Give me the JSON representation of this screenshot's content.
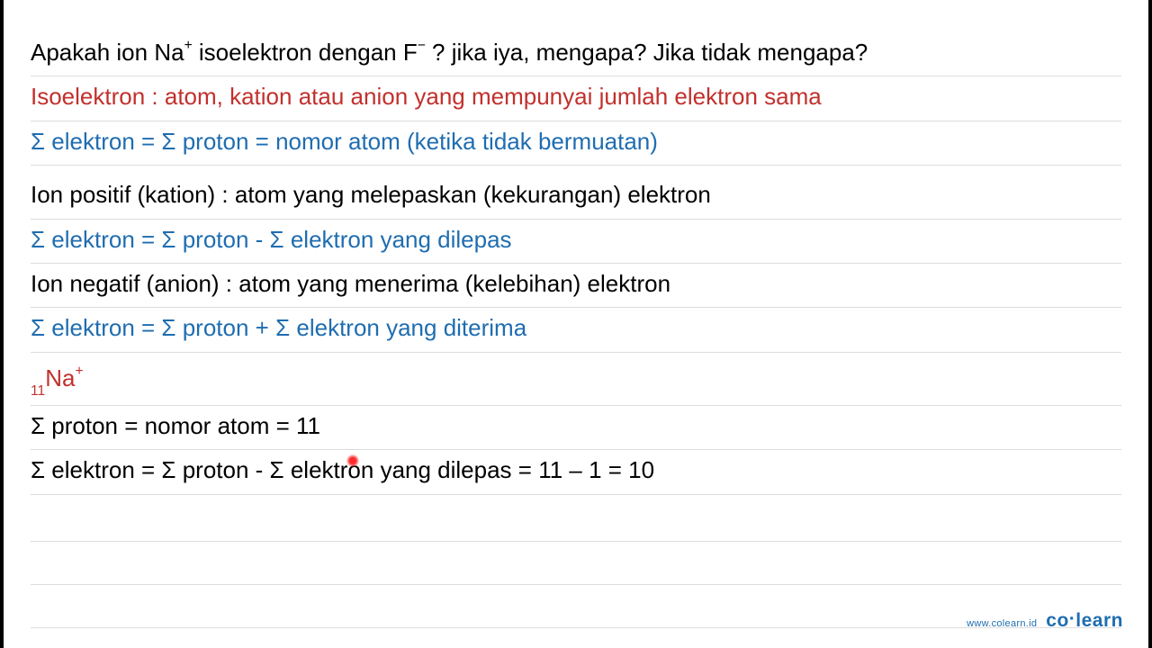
{
  "q": {
    "pre": "Apakah ion Na",
    "sup1": "+",
    "mid": " isoelektron dengan F",
    "sup2": "−",
    "post": "  ? jika iya, mengapa? Jika tidak mengapa?"
  },
  "def": "Isoelektron : atom, kation atau anion yang mempunyai jumlah elektron sama",
  "eq1": "Σ elektron = Σ proton = nomor atom (ketika tidak bermuatan)",
  "kation": "Ion positif (kation) : atom yang melepaskan (kekurangan) elektron",
  "eq2": "Σ elektron = Σ proton - Σ elektron yang dilepas",
  "anion": "Ion negatif (anion) : atom yang menerima (kelebihan) elektron",
  "eq3": "Σ elektron = Σ proton + Σ elektron yang diterima",
  "na": {
    "sub": "11",
    "sym": "Na",
    "sup": "+"
  },
  "proton": "Σ proton = nomor atom = 11",
  "elektron_calc": "Σ elektron = Σ proton - Σ elektron yang dilepas = 11 – 1 = 10",
  "footer": {
    "url": "www.colearn.id",
    "logo_a": "co",
    "logo_dot": "·",
    "logo_b": "learn"
  }
}
